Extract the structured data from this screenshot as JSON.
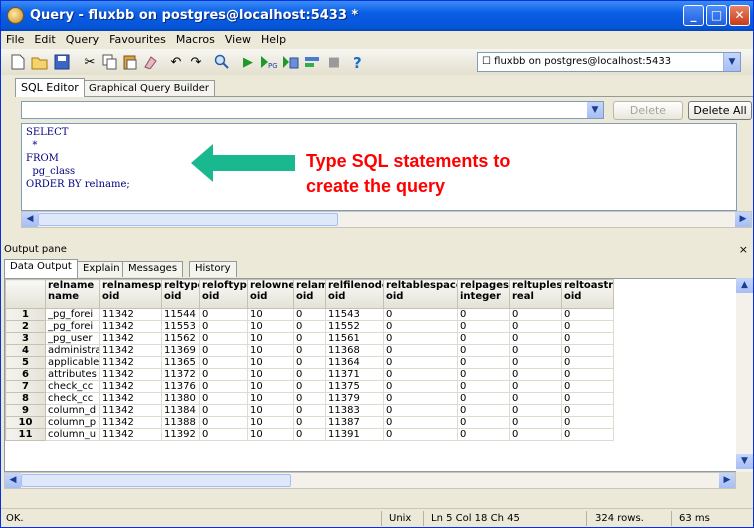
{
  "window": {
    "title": "Query - fluxbb on postgres@localhost:5433 *"
  },
  "menu": [
    "File",
    "Edit",
    "Query",
    "Favourites",
    "Macros",
    "View",
    "Help"
  ],
  "toolbar": {
    "connection": "fluxbb on postgres@localhost:5433"
  },
  "editor": {
    "tabs": [
      "SQL Editor",
      "Graphical Query Builder"
    ],
    "delete_label": "Delete",
    "delete_all_label": "Delete All",
    "sql": "SELECT\n  *\nFROM\n  pg_class\nORDER BY relname;"
  },
  "annotation": {
    "text": "Type SQL statements to\ncreate the query",
    "color": "#ff0000",
    "arrow_color": "#1ab88e"
  },
  "output": {
    "title": "Output pane",
    "close": "×",
    "tabs": [
      "Data Output",
      "Explain",
      "Messages",
      "History"
    ],
    "columns": [
      [
        "relname",
        "name"
      ],
      [
        "relnamespace",
        "oid"
      ],
      [
        "reltype",
        "oid"
      ],
      [
        "reloftype",
        "oid"
      ],
      [
        "relowner",
        "oid"
      ],
      [
        "relam",
        "oid"
      ],
      [
        "relfilenode",
        "oid"
      ],
      [
        "reltablespace",
        "oid"
      ],
      [
        "relpages",
        "integer"
      ],
      [
        "reltuples",
        "real"
      ],
      [
        "reltoastre",
        "oid"
      ]
    ],
    "rows": [
      [
        "1",
        "_pg_forei",
        "11342",
        "11544",
        "0",
        "10",
        "0",
        "11543",
        "0",
        "0",
        "0",
        "0"
      ],
      [
        "2",
        "_pg_forei",
        "11342",
        "11553",
        "0",
        "10",
        "0",
        "11552",
        "0",
        "0",
        "0",
        "0"
      ],
      [
        "3",
        "_pg_user",
        "11342",
        "11562",
        "0",
        "10",
        "0",
        "11561",
        "0",
        "0",
        "0",
        "0"
      ],
      [
        "4",
        "administra",
        "11342",
        "11369",
        "0",
        "10",
        "0",
        "11368",
        "0",
        "0",
        "0",
        "0"
      ],
      [
        "5",
        "applicable",
        "11342",
        "11365",
        "0",
        "10",
        "0",
        "11364",
        "0",
        "0",
        "0",
        "0"
      ],
      [
        "6",
        "attributes",
        "11342",
        "11372",
        "0",
        "10",
        "0",
        "11371",
        "0",
        "0",
        "0",
        "0"
      ],
      [
        "7",
        "check_cc",
        "11342",
        "11376",
        "0",
        "10",
        "0",
        "11375",
        "0",
        "0",
        "0",
        "0"
      ],
      [
        "8",
        "check_cc",
        "11342",
        "11380",
        "0",
        "10",
        "0",
        "11379",
        "0",
        "0",
        "0",
        "0"
      ],
      [
        "9",
        "column_d",
        "11342",
        "11384",
        "0",
        "10",
        "0",
        "11383",
        "0",
        "0",
        "0",
        "0"
      ],
      [
        "10",
        "column_p",
        "11342",
        "11388",
        "0",
        "10",
        "0",
        "11387",
        "0",
        "0",
        "0",
        "0"
      ],
      [
        "11",
        "column_u",
        "11342",
        "11392",
        "0",
        "10",
        "0",
        "11391",
        "0",
        "0",
        "0",
        "0"
      ]
    ]
  },
  "status": {
    "message": "OK.",
    "encoding": "Unix",
    "position": "Ln 5 Col 18 Ch 45",
    "rows": "324 rows.",
    "time": "63 ms"
  }
}
